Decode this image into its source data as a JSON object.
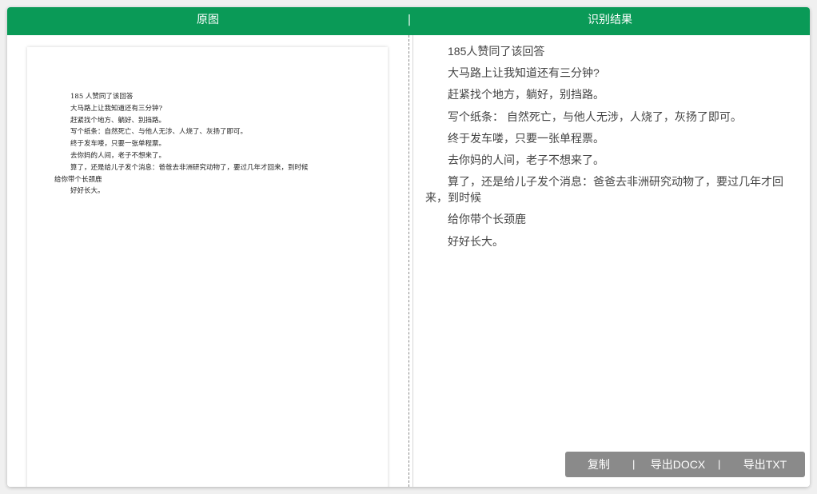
{
  "header": {
    "left_title": "原图",
    "separator": "|",
    "right_title": "识别结果"
  },
  "original_image": {
    "lines": [
      "185 人赞同了该回答",
      "大马路上让我知道还有三分钟?",
      "赶紧找个地方、躺好、别挡路。",
      "写个纸条：自然死亡、与他人无涉、人烧了、灰扬了即可。",
      "终于发车喽，只要一张单程票。",
      "去你妈的人间，老子不想来了。",
      "算了，还是给儿子发个消息：爸爸去非洲研究动物了，要过几年才回来，到时候",
      "给你带个长颈鹿",
      "好好长大。"
    ]
  },
  "result": {
    "paragraphs": [
      "185人赞同了该回答",
      "大马路上让我知道还有三分钟?",
      "赶紧找个地方，躺好，别挡路。",
      "写个纸条： 自然死亡，与他人无涉，人烧了，灰扬了即可。",
      "终于发车喽，只要一张单程票。",
      "去你妈的人间，老子不想来了。",
      "算了，还是给儿子发个消息：爸爸去非洲研究动物了，要过几年才回来，到时候",
      "给你带个长颈鹿",
      "好好长大。"
    ]
  },
  "toolbar": {
    "copy_label": "复制",
    "export_docx_label": "导出DOCX",
    "export_txt_label": "导出TXT",
    "separator": "|"
  },
  "colors": {
    "header_bg": "#0a9a57",
    "toolbar_bg": "#8a8a8a"
  }
}
